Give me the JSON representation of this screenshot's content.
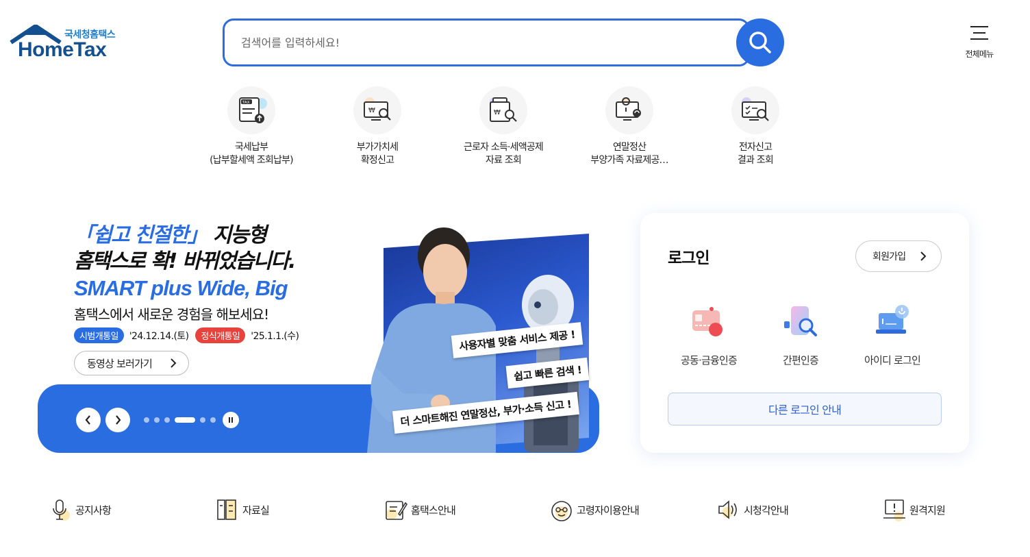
{
  "header": {
    "logo_sub": "국세청홈택스",
    "logo_main": "HomeTax",
    "search_placeholder": "검색어를 입력하세요!",
    "all_menu_label": "전체메뉴"
  },
  "quick_menu": [
    {
      "label": "국세납부\n(납부할세액 조회납부)",
      "icon": "tax-payment-icon"
    },
    {
      "label": "부가가치세\n확정신고",
      "icon": "vat-report-icon"
    },
    {
      "label": "근로자 소득·세액공제\n자료 조회",
      "icon": "income-deduction-icon"
    },
    {
      "label": "연말정산\n부양가족 자료제공…",
      "icon": "year-end-settlement-icon"
    },
    {
      "label": "전자신고\n결과 조회",
      "icon": "e-filing-result-icon"
    }
  ],
  "banner": {
    "line1_bracket": "「쉽고 친절한」",
    "line1_rest": " 지능형",
    "line2": "홈택스로 확! 바뀌었습니다.",
    "line3": "SMART plus Wide, Big",
    "line4": "홈택스에서 새로운 경험을 해보세요!",
    "badge1": "시범개통일",
    "date1": "'24.12.14.(토)",
    "badge2": "정식개통일",
    "date2": "'25.1.1.(수)",
    "video_button": "동영상 보러가기",
    "tags": [
      "사용자별 맞춤 서비스 제공 !",
      "쉽고 빠른 검색 !",
      "더 스마트해진 연말정산, 부가·소득 신고 !"
    ],
    "dots_count": 6,
    "active_dot": 3
  },
  "login": {
    "title": "로그인",
    "join_button": "회원가입",
    "options": [
      {
        "label": "공동·금융인증",
        "icon": "certificate-icon"
      },
      {
        "label": "간편인증",
        "icon": "simple-auth-icon"
      },
      {
        "label": "아이디 로그인",
        "icon": "id-login-icon"
      }
    ],
    "other_login": "다른 로그인 안내"
  },
  "bottom_links": [
    {
      "label": "공지사항",
      "icon": "microphone-icon"
    },
    {
      "label": "자료실",
      "icon": "archive-icon"
    },
    {
      "label": "홈택스안내",
      "icon": "guide-icon"
    },
    {
      "label": "고령자이용안내",
      "icon": "senior-icon"
    },
    {
      "label": "시청각안내",
      "icon": "speaker-icon"
    },
    {
      "label": "원격지원",
      "icon": "remote-support-icon"
    }
  ],
  "colors": {
    "primary": "#2a6de1",
    "badge_red": "#e8423c",
    "logo_navy": "#14508f",
    "logo_blue": "#1f7ecb"
  }
}
